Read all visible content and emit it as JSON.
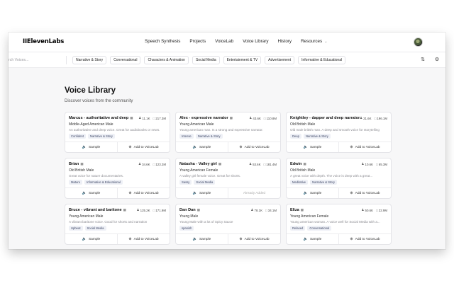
{
  "app": {
    "logo": "IIElevenLabs"
  },
  "nav": {
    "links": [
      "Speech Synthesis",
      "Projects",
      "VoiceLab",
      "Voice Library",
      "History",
      "Resources"
    ]
  },
  "filters": {
    "search_placeholder": "rch Voices...",
    "chips": [
      "Narrative & Story",
      "Conversational",
      "Characters & Animation",
      "Social Media",
      "Entertainment & TV",
      "Advertisement",
      "Informative & Educational"
    ]
  },
  "page": {
    "title": "Voice Library",
    "subtitle": "Discover voices from the community"
  },
  "actions": {
    "sample": "Sample",
    "add": "Add to VoiceLab",
    "already_added": "Already Added"
  },
  "cards": [
    {
      "name": "Marcus - authoritative and deep",
      "users": "11.1K",
      "chars": "217.3M",
      "sub": "Middle-Aged American Male",
      "desc": "An authoritative and deep voice. Great for audiobooks or news.",
      "tags": [
        "Confident",
        "Narrative & Story"
      ],
      "added": false
    },
    {
      "name": "Alex - expressive narrator",
      "users": "43.6K",
      "chars": "110.8M",
      "sub": "Young American Male",
      "desc": "Young american man. Is a strong and expressive narrator.",
      "tags": [
        "Intense",
        "Narrative & Story"
      ],
      "added": false
    },
    {
      "name": "Knightley - dapper and deep narrator",
      "users": "21.6K",
      "chars": "196.1M",
      "sub": "Old British Male",
      "desc": "Old male british man. A deep and smooth voice for storytelling",
      "tags": [
        "Deep",
        "Narrative & Story"
      ],
      "added": false
    },
    {
      "name": "Brian",
      "users": "34.6K",
      "chars": "123.2M",
      "sub": "Old British Male",
      "desc": "Great voice for nature documentaries.",
      "tags": [
        "Mature",
        "Informative & Educational"
      ],
      "added": false
    },
    {
      "name": "Natasha - Valley girl",
      "users": "53.6K",
      "chars": "181.4M",
      "sub": "Young American Female",
      "desc": "A valley girl female voice. Great for shorts.",
      "tags": [
        "Sassy",
        "Social Media"
      ],
      "added": true
    },
    {
      "name": "Edwin",
      "users": "10.6K",
      "chars": "65.3M",
      "sub": "Old British Male",
      "desc": "A great voice with depth. The voice is deep with a great...",
      "tags": [
        "Meditative",
        "Narrative & Story"
      ],
      "added": false
    },
    {
      "name": "Bruce - vibrant and baritone",
      "users": "125.2K",
      "chars": "171.9M",
      "sub": "Young American Male",
      "desc": "A vibrant baritone voice. Good for shorts and narration",
      "tags": [
        "Upbeat",
        "Social Media"
      ],
      "added": false
    },
    {
      "name": "Dan Dan",
      "users": "78.1K",
      "chars": "34.1M",
      "sub": "Young Male",
      "desc": "Young Male with a lot of Spicy Sauce",
      "tags": [
        "spanish"
      ],
      "added": false
    },
    {
      "name": "Eliza",
      "users": "50.6K",
      "chars": "22.9M",
      "sub": "Young American Female",
      "desc": "Young american woman. A voice well for Social Media with a...",
      "tags": [
        "Relaxed",
        "Conversational"
      ],
      "added": false
    }
  ]
}
